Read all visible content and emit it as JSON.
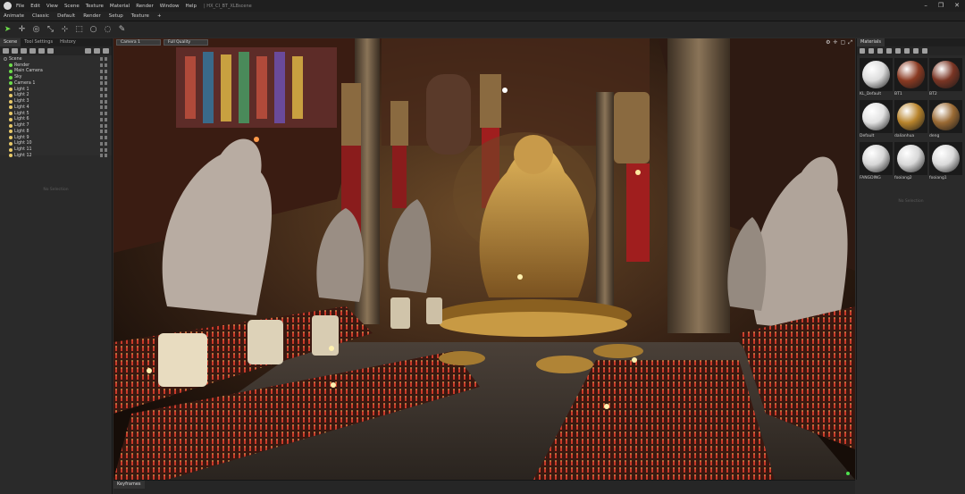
{
  "app": {
    "menu": [
      "File",
      "Edit",
      "View",
      "Scene",
      "Texture",
      "Material",
      "Render",
      "Window",
      "Help"
    ],
    "document_title": "| HX_CI_BT_XLBscene"
  },
  "modebar": {
    "items": [
      "Animate",
      "Classic",
      "Default",
      "Render",
      "Setup",
      "Texture",
      "+"
    ]
  },
  "toolbar": {
    "tools": [
      "select-tool-icon",
      "move-tool-icon",
      "rotate-tool-icon",
      "scale-tool-icon",
      "pivot-tool-icon",
      "box-select-icon",
      "circle-select-icon",
      "lasso-select-icon",
      "paint-select-icon"
    ],
    "active_color": "#6ddc4a"
  },
  "left_panel": {
    "tabs": [
      "Scene",
      "Tool Settings",
      "History"
    ],
    "active_tab": "Scene",
    "tree": [
      {
        "label": "Scene",
        "kind": "scene"
      },
      {
        "label": "Render",
        "kind": "node"
      },
      {
        "label": "Main Camera",
        "kind": "node"
      },
      {
        "label": "Sky",
        "kind": "node"
      },
      {
        "label": "Camera 1",
        "kind": "node"
      },
      {
        "label": "Light 1",
        "kind": "light"
      },
      {
        "label": "Light 2",
        "kind": "light"
      },
      {
        "label": "Light 3",
        "kind": "light"
      },
      {
        "label": "Light 4",
        "kind": "light"
      },
      {
        "label": "Light 5",
        "kind": "light"
      },
      {
        "label": "Light 6",
        "kind": "light"
      },
      {
        "label": "Light 7",
        "kind": "light"
      },
      {
        "label": "Light 8",
        "kind": "light"
      },
      {
        "label": "Light 9",
        "kind": "light"
      },
      {
        "label": "Light 10",
        "kind": "light"
      },
      {
        "label": "Light 11",
        "kind": "light"
      },
      {
        "label": "Light 12",
        "kind": "light"
      }
    ],
    "no_selection": "No Selection"
  },
  "viewport": {
    "camera": "Camera 1",
    "quality": "Full Quality"
  },
  "materials": {
    "title": "Materials",
    "items": [
      {
        "label": "KL_Default",
        "color": "#dcdcdc"
      },
      {
        "label": "BT1",
        "color": "#8a3a22"
      },
      {
        "label": "BT2",
        "color": "#7a3524"
      },
      {
        "label": "Default",
        "color": "#e2e2e2"
      },
      {
        "label": "dalianhua",
        "color": "#b8842c"
      },
      {
        "label": "deng",
        "color": "#9a6a34"
      },
      {
        "label": "FANGDING",
        "color": "#d6d6d6"
      },
      {
        "label": "fooiang2",
        "color": "#d8d8d8"
      },
      {
        "label": "fooiang1",
        "color": "#dadada"
      }
    ],
    "no_selection": "No Selection"
  },
  "bottom": {
    "keyframes_tab": "Keyframes"
  }
}
